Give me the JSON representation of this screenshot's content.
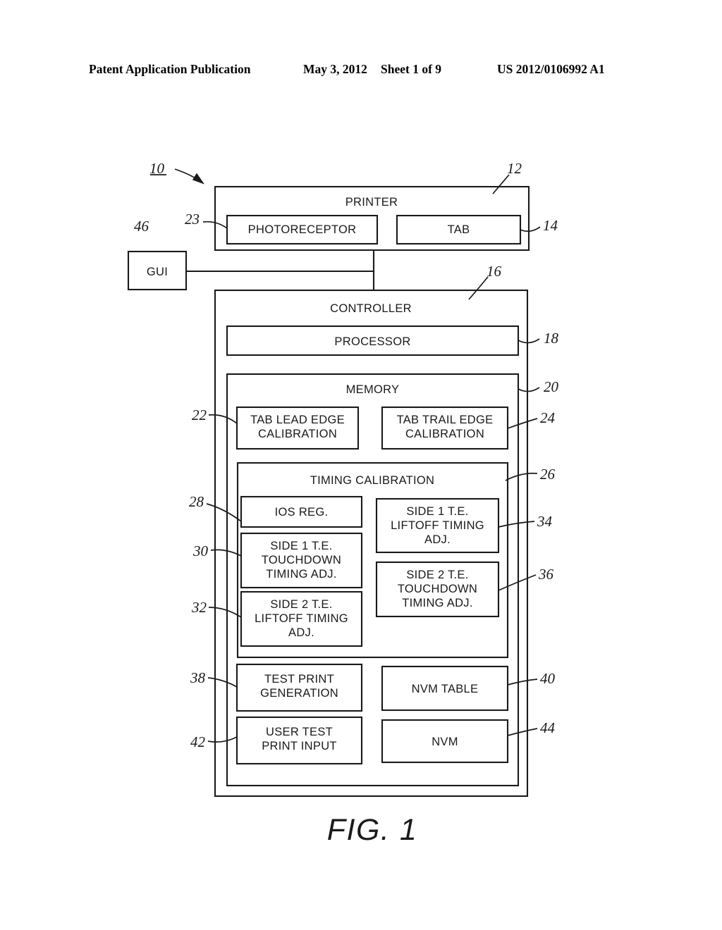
{
  "header": {
    "title": "Patent Application Publication",
    "date": "May 3, 2012",
    "sheet": "Sheet 1 of 9",
    "publication_number": "US 2012/0106992 A1"
  },
  "figure": {
    "caption": "FIG. 1",
    "system_ref": "10"
  },
  "blocks": {
    "printer": {
      "label": "PRINTER",
      "ref": "12"
    },
    "photoreceptor": {
      "label": "PHOTORECEPTOR",
      "ref": "23"
    },
    "tab": {
      "label": "TAB",
      "ref": "14"
    },
    "gui": {
      "label": "GUI",
      "ref": "46"
    },
    "controller": {
      "label": "CONTROLLER",
      "ref": "16"
    },
    "processor": {
      "label": "PROCESSOR",
      "ref": "18"
    },
    "memory": {
      "label": "MEMORY",
      "ref": "20"
    },
    "tab_lead_edge_calibration": {
      "line1": "TAB LEAD EDGE",
      "line2": "CALIBRATION",
      "ref": "22"
    },
    "tab_trail_edge_calibration": {
      "line1": "TAB TRAIL EDGE",
      "line2": "CALIBRATION",
      "ref": "24"
    },
    "timing_calibration": {
      "label": "TIMING CALIBRATION",
      "ref": "26"
    },
    "ios_reg": {
      "line1": "IOS REG.",
      "ref": "28"
    },
    "side1_te_touchdown": {
      "line1": "SIDE 1 T.E.",
      "line2": "TOUCHDOWN",
      "line3": "TIMING ADJ.",
      "ref": "30"
    },
    "side2_te_liftoff": {
      "line1": "SIDE 2 T.E.",
      "line2": "LIFTOFF TIMING",
      "line3": "ADJ.",
      "ref": "32"
    },
    "side1_te_liftoff": {
      "line1": "SIDE 1 T.E.",
      "line2": "LIFTOFF TIMING",
      "line3": "ADJ.",
      "ref": "34"
    },
    "side2_te_touchdown": {
      "line1": "SIDE 2 T.E.",
      "line2": "TOUCHDOWN",
      "line3": "TIMING ADJ.",
      "ref": "36"
    },
    "test_print_generation": {
      "line1": "TEST PRINT",
      "line2": "GENERATION",
      "ref": "38"
    },
    "nvm_table": {
      "line1": "NVM TABLE",
      "ref": "40"
    },
    "user_test_print_input": {
      "line1": "USER TEST",
      "line2": "PRINT INPUT",
      "ref": "42"
    },
    "nvm": {
      "line1": "NVM",
      "ref": "44"
    }
  },
  "colors": {
    "ink": "#1a1a1a",
    "paper": "#ffffff"
  }
}
